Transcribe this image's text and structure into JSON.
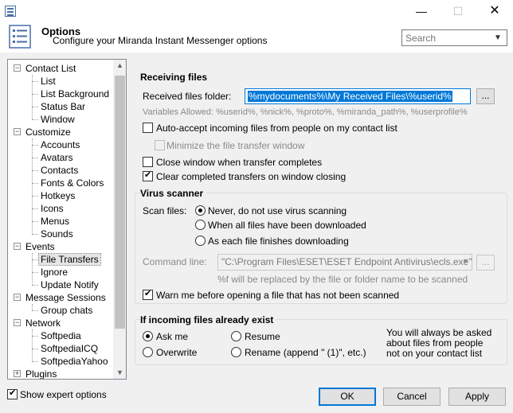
{
  "window": {
    "min_glyph": "—",
    "max_glyph": "☐",
    "close_glyph": "✕"
  },
  "header": {
    "title": "Options",
    "subtitle": "Configure your Miranda Instant Messenger options",
    "search_placeholder": "Search"
  },
  "tree": {
    "nodes": [
      {
        "label": "Contact List",
        "level": 0,
        "expanded": true
      },
      {
        "label": "List",
        "level": 1
      },
      {
        "label": "List Background",
        "level": 1
      },
      {
        "label": "Status Bar",
        "level": 1
      },
      {
        "label": "Window",
        "level": 1
      },
      {
        "label": "Customize",
        "level": 0,
        "expanded": true
      },
      {
        "label": "Accounts",
        "level": 1
      },
      {
        "label": "Avatars",
        "level": 1
      },
      {
        "label": "Contacts",
        "level": 1
      },
      {
        "label": "Fonts & Colors",
        "level": 1
      },
      {
        "label": "Hotkeys",
        "level": 1
      },
      {
        "label": "Icons",
        "level": 1
      },
      {
        "label": "Menus",
        "level": 1
      },
      {
        "label": "Sounds",
        "level": 1
      },
      {
        "label": "Events",
        "level": 0,
        "expanded": true
      },
      {
        "label": "File Transfers",
        "level": 1,
        "selected": true
      },
      {
        "label": "Ignore",
        "level": 1
      },
      {
        "label": "Update Notify",
        "level": 1
      },
      {
        "label": "Message Sessions",
        "level": 0,
        "expanded": true
      },
      {
        "label": "Group chats",
        "level": 1
      },
      {
        "label": "Network",
        "level": 0,
        "expanded": true
      },
      {
        "label": "Softpedia",
        "level": 1
      },
      {
        "label": "SoftpediaICQ",
        "level": 1
      },
      {
        "label": "SoftpediaYahoo",
        "level": 1
      },
      {
        "label": "Plugins",
        "level": 0,
        "expanded": false
      }
    ]
  },
  "receiving": {
    "title": "Receiving files",
    "folder_label": "Received files folder:",
    "folder_value": "%mydocuments%\\My Received Files\\%userid%",
    "browse_label": "...",
    "variables_hint": "Variables Allowed: %userid%, %nick%, %proto%, %miranda_path%, %userprofile%",
    "auto_accept": "Auto-accept incoming files from people on my contact list",
    "minimize": "Minimize the file transfer window",
    "close_window": "Close window when transfer completes",
    "clear_completed": "Clear completed transfers on window closing"
  },
  "virus": {
    "title": "Virus scanner",
    "scan_label": "Scan files:",
    "opt_never": "Never, do not use virus scanning",
    "opt_all": "When all files have been downloaded",
    "opt_each": "As each file finishes downloading",
    "command_label": "Command line:",
    "command_value": "\"C:\\Program Files\\ESET\\ESET Endpoint Antivirus\\ecls.exe\" /log",
    "command_hint": "%f will be replaced by the file or folder name to be scanned",
    "browse_label": "...",
    "warn": "Warn me before opening a file that has not been scanned"
  },
  "exists": {
    "title": "If incoming files already exist",
    "ask": "Ask me",
    "resume": "Resume",
    "overwrite": "Overwrite",
    "rename": "Rename (append \" (1)\", etc.)",
    "note": "You will always be asked about files from people not on your contact list"
  },
  "footer": {
    "expert": "Show expert options",
    "ok": "OK",
    "cancel": "Cancel",
    "apply": "Apply"
  },
  "colors": {
    "accent": "#0078d7",
    "background": "#f0f0f0"
  }
}
